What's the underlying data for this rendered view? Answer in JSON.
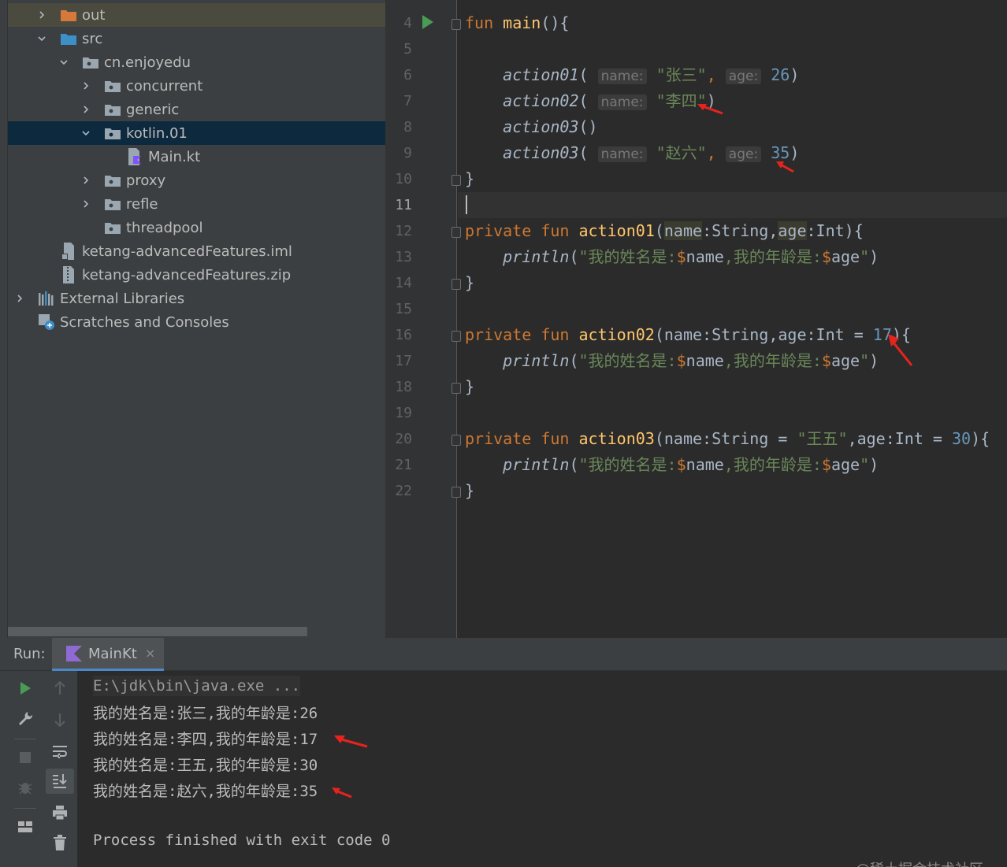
{
  "project_tree": {
    "items": [
      {
        "label": "out",
        "icon": "folder-icon",
        "expanded": false
      },
      {
        "label": "src",
        "icon": "source-folder-icon",
        "expanded": true
      },
      {
        "label": "cn.enjoyedu",
        "icon": "package-icon",
        "expanded": true
      },
      {
        "label": "concurrent",
        "icon": "package-icon",
        "expanded": false
      },
      {
        "label": "generic",
        "icon": "package-icon",
        "expanded": false
      },
      {
        "label": "kotlin.01",
        "icon": "package-icon",
        "expanded": true,
        "selected": true
      },
      {
        "label": "Main.kt",
        "icon": "kotlin-file-icon"
      },
      {
        "label": "proxy",
        "icon": "package-icon",
        "expanded": false
      },
      {
        "label": "refle",
        "icon": "package-icon",
        "expanded": false
      },
      {
        "label": "threadpool",
        "icon": "package-icon"
      },
      {
        "label": "ketang-advancedFeatures.iml",
        "icon": "iml-file-icon"
      },
      {
        "label": "ketang-advancedFeatures.zip",
        "icon": "zip-file-icon"
      },
      {
        "label": "External Libraries",
        "icon": "library-icon",
        "expanded": false
      },
      {
        "label": "Scratches and Consoles",
        "icon": "scratches-icon"
      }
    ]
  },
  "editor": {
    "line_numbers": [
      "4",
      "5",
      "6",
      "7",
      "8",
      "9",
      "10",
      "11",
      "12",
      "13",
      "14",
      "15",
      "16",
      "17",
      "18",
      "19",
      "20",
      "21",
      "22"
    ],
    "current_line": "11",
    "code": {
      "l4_kw": "fun",
      "l4_name": "main",
      "l4_rest": "(){",
      "l6_call": "action01",
      "l6_hint_name": "name:",
      "l6_str": "\"张三\"",
      "l6_hint_age": "age:",
      "l6_num": "26",
      "l7_call": "action02",
      "l7_hint_name": "name:",
      "l7_str": "\"李四\"",
      "l8_call": "action03",
      "l9_call": "action03",
      "l9_hint_name": "name:",
      "l9_str": "\"赵六\"",
      "l9_hint_age": "age:",
      "l9_num": "35",
      "close_brace": "}",
      "private_kw": "private",
      "fun_kw": "fun",
      "l12_name": "action01",
      "l12_p1": "name",
      "l12_p1_type": ":String,",
      "l12_p2": "age",
      "l12_p2_type": ":Int){",
      "println": "println",
      "println_str_a": "\"我的姓名是:",
      "println_var_name": "name",
      "println_str_b": ",我的年龄是:",
      "println_var_age": "age",
      "println_str_c": "\"",
      "l16_name": "action02",
      "l16_params": "(name:String,age:Int = ",
      "l16_num": "17",
      "l16_end": "){",
      "l20_name": "action03",
      "l20_params_a": "(name:String = ",
      "l20_str": "\"王五\"",
      "l20_params_b": ",age:Int = ",
      "l20_num": "30",
      "l20_end": "){"
    }
  },
  "run_panel": {
    "label": "Run:",
    "tab_name": "MainKt",
    "tab_close": "×",
    "console": {
      "command": "E:\\jdk\\bin\\java.exe ...",
      "lines": [
        "我的姓名是:张三,我的年龄是:26",
        "我的姓名是:李四,我的年龄是:17",
        "我的姓名是:王五,我的年龄是:30",
        "我的姓名是:赵六,我的年龄是:35"
      ],
      "exit": "Process finished with exit code 0"
    },
    "watermark": "@稀土掘金技术社区"
  },
  "colors": {
    "keyword": "#cc7832",
    "function_decl": "#ffc66d",
    "string": "#6a8759",
    "number": "#6897bb",
    "annotation_arrow": "#e8231e",
    "selection": "#0d293e"
  }
}
